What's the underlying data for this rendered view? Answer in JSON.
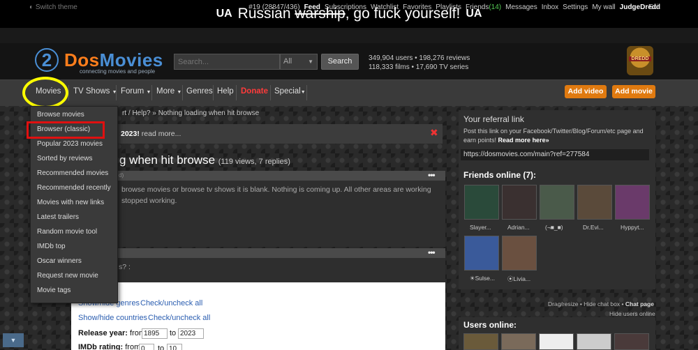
{
  "banner": {
    "flag_left": "UA",
    "pre": "Russian ",
    "struck": "warship",
    "post": ", go fuck yourself!",
    "flag_right": "UA"
  },
  "userbar": {
    "switch_theme": "Switch theme",
    "links": [
      {
        "label": "#19 (28847/436)"
      },
      {
        "label": "Feed",
        "bold": true
      },
      {
        "label": "Subscriptions"
      },
      {
        "label": "Watchlist"
      },
      {
        "label": "Favorites"
      },
      {
        "label": "Playlists"
      },
      {
        "label": "Friends"
      },
      {
        "label": "(14)",
        "green": true
      },
      {
        "label": "Messages"
      },
      {
        "label": "Inbox"
      },
      {
        "label": "Settings"
      },
      {
        "label": "My wall"
      },
      {
        "label": "JudgeDredd",
        "bold": true
      }
    ],
    "exit": "Exit"
  },
  "header": {
    "logo_digit": "2",
    "logo_dos": "Dos",
    "logo_movies": "Movies",
    "logo_sub": "connecting movies and people",
    "search_placeholder": "Search...",
    "search_select": "All",
    "search_button": "Search",
    "stats_line1": "349,904 users • 198,276 reviews",
    "stats_line2": "118,333 films • 17,690 TV series",
    "avatar_label": "DREDD"
  },
  "nav": {
    "movies": "Movies",
    "tvshows": "TV Shows",
    "forum": "Forum",
    "more": "More",
    "genres": "Genres",
    "help": "Help",
    "donate": "Donate",
    "special": "Special",
    "add_video": "Add video",
    "add_movie": "Add movie"
  },
  "dropdown": [
    "Browse movies",
    "Browser (classic)",
    "Popular 2023 movies",
    "Sorted by reviews",
    "Recommended movies",
    "Recommended recently",
    "Movies with new links",
    "Latest trailers",
    "Random movie tool",
    "IMDb top",
    "Oscar winners",
    "Request new movie",
    "Movie tags"
  ],
  "main": {
    "breadcrumb": "rt / Help? »  Nothing loading when hit browse",
    "notice_bold": "2023!",
    "notice_link": "read more...",
    "notice_close": "✖",
    "title": "g when hit browse",
    "title_meta": "(119 views, 7 replies)",
    "post1_small": "d)",
    "post1_line1": "browse movies or browse tv shows it is blank. Nothing is coming up. All other areas are working",
    "post1_line2": "stopped working.",
    "post2_text": "s? :",
    "dots": "•••",
    "filter": {
      "show_genres": "Show/hide genres",
      "check_genres": "Check/uncheck all",
      "show_countries": "Show/hide countries",
      "check_countries": "Check/uncheck all",
      "release_label": "Release year:",
      "from": "from",
      "to": "to",
      "release_from": "1895",
      "release_to": "2023",
      "imdb_label": "IMDb rating:",
      "imdb_from": "0",
      "imdb_to": "10"
    },
    "scroll_icon": "▼"
  },
  "right": {
    "ref_title": "Your referral link",
    "ref_desc1": "Post this link on your Facebook/Twitter/Blog/Forum/etc page and",
    "ref_desc2_pre": "earn points!",
    "ref_desc2_link": "Read more here»",
    "ref_link": "https://dosmovies.com/main?ref=277584",
    "friends_title": "Friends online (7):",
    "friends": [
      {
        "name": "Slayer...",
        "color": "#2a4a3a"
      },
      {
        "name": "Adrian...",
        "color": "#3a3030"
      },
      {
        "name": "(¬■_■)",
        "color": "#4a5a4a"
      },
      {
        "name": "Dr.Evi...",
        "color": "#5a4a3a"
      },
      {
        "name": "Hyppyt...",
        "color": "#6a3a6a"
      },
      {
        "name": "☀Sulse...",
        "color": "#3a5a9a"
      },
      {
        "name": "⦿Livia...",
        "color": "#6a5040"
      }
    ],
    "chat_links_pre": "Drag/resize  •  Hide chat box  •",
    "chat_page": "Chat page",
    "hide_users": "Hide users online",
    "users_title": "Users online:"
  }
}
